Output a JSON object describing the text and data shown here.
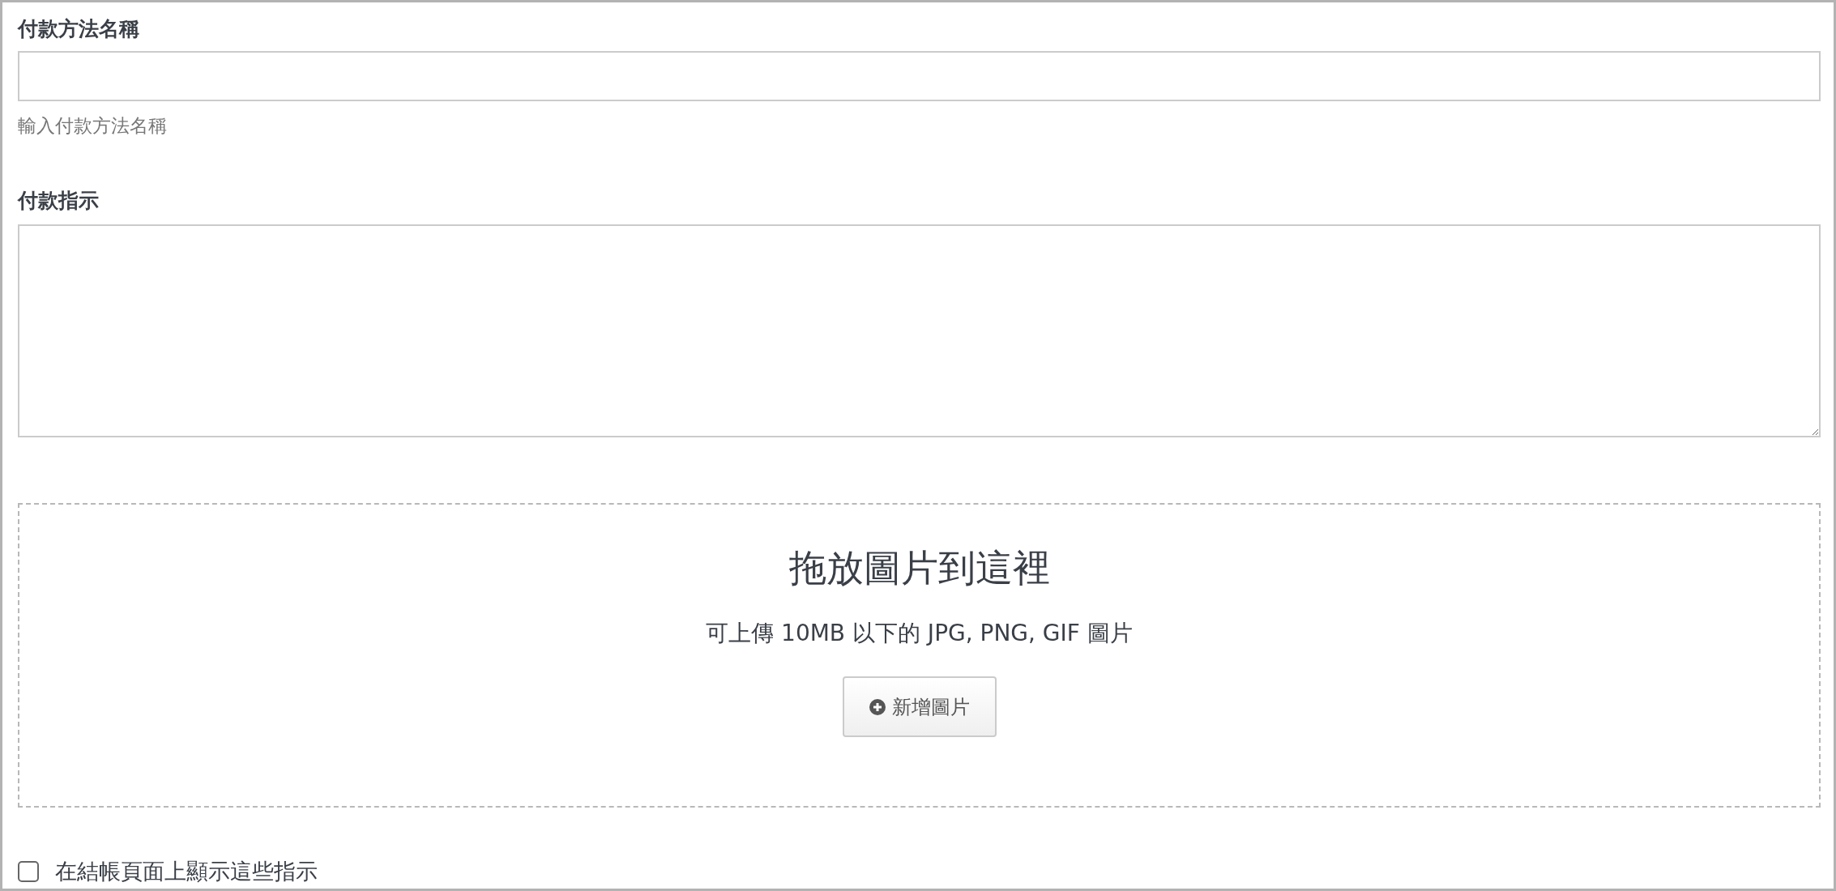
{
  "name_field": {
    "label": "付款方法名稱",
    "hint": "輸入付款方法名稱"
  },
  "instructions_field": {
    "label": "付款指示"
  },
  "dropzone": {
    "title": "拖放圖片到這裡",
    "subtitle": "可上傳 10MB 以下的 JPG, PNG, GIF 圖片",
    "button": "新增圖片"
  },
  "show_on_checkout": {
    "label": "在結帳頁面上顯示這些指示",
    "checked": false
  }
}
